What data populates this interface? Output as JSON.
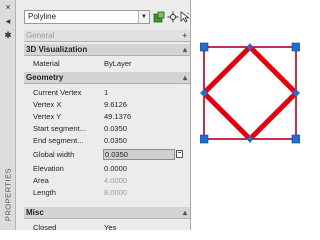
{
  "strip": {
    "close_icon": "×",
    "pin_icon": "◂",
    "settings_icon": "✱",
    "vertical_title": "PROPERTIES"
  },
  "toolbar": {
    "object_select": "Polyline",
    "icons": [
      "select-objects-icon",
      "quick-select-icon",
      "pickadd-toggle-icon"
    ]
  },
  "sections": {
    "general": {
      "title": "General",
      "toggle": "+"
    },
    "viz3d": {
      "title": "3D Visualization",
      "toggle": "▴",
      "rows": [
        {
          "label": "Material",
          "value": "ByLayer"
        }
      ]
    },
    "geometry": {
      "title": "Geometry",
      "toggle": "▴",
      "rows": [
        {
          "label": "Current Vertex",
          "value": "1"
        },
        {
          "label": "Vertex X",
          "value": "9.6126"
        },
        {
          "label": "Vertex Y",
          "value": "49.1376"
        },
        {
          "label": "Start segment...",
          "value": "0.0350"
        },
        {
          "label": "End segment...",
          "value": "0.0350"
        },
        {
          "label": "Global width",
          "value": "0.0350"
        },
        {
          "label": "Elevation",
          "value": "0.0000"
        },
        {
          "label": "Area",
          "value": "4.0000"
        },
        {
          "label": "Length",
          "value": "8.0000"
        }
      ]
    },
    "misc": {
      "title": "Misc",
      "toggle": "▴",
      "rows": [
        {
          "label": "Closed",
          "value": "Yes"
        }
      ]
    }
  },
  "colors": {
    "square": "#c0304a",
    "diamond": "#e3000f",
    "grip": "#1f6fd1"
  }
}
